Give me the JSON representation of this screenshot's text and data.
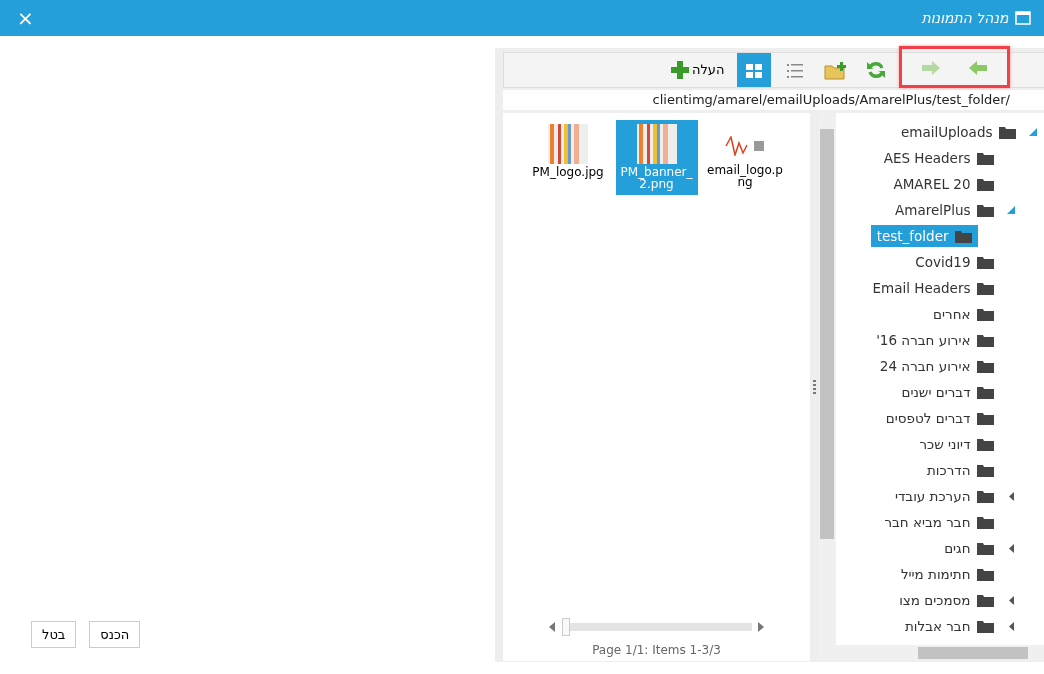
{
  "window": {
    "title": "מנהל התמונות",
    "close": "×"
  },
  "toolbar": {
    "nav": [
      {
        "kind": "back",
        "disabled": false
      },
      {
        "kind": "forward",
        "disabled": true
      }
    ],
    "views": [
      {
        "kind": "list",
        "selected": false
      },
      {
        "kind": "grid",
        "selected": true
      }
    ],
    "upload": "העלה"
  },
  "path": "clientimg/amarel/emailUploads/AmarelPlus/test_folder/",
  "files": [
    {
      "name": "email_logo.png",
      "selected": false,
      "kind": "logo"
    },
    {
      "name": "PM_banner_2.png",
      "selected": true,
      "kind": "stripes"
    },
    {
      "name": "PM_logo.jpg",
      "selected": false,
      "kind": "stripes"
    }
  ],
  "pager": {
    "level": 0,
    "text": "Page 1/1: Items 1-3/3"
  },
  "tree": [
    {
      "label": "emailUploads",
      "expanded": true,
      "selected": false,
      "children": [
        {
          "label": "AES Headers",
          "selected": false
        },
        {
          "label": "AMAREL 20",
          "selected": false
        },
        {
          "label": "AmarelPlus",
          "expanded": true,
          "selected": false,
          "children": [
            {
              "label": "test_folder",
              "selected": true
            }
          ]
        },
        {
          "label": "Covid19",
          "selected": false
        },
        {
          "label": "Email Headers",
          "selected": false
        },
        {
          "label": "אחרים",
          "selected": false
        },
        {
          "label": "אירוע חברה 16'",
          "selected": false
        },
        {
          "label": "אירוע חברה 24",
          "selected": false
        },
        {
          "label": "דברים ישנים",
          "selected": false
        },
        {
          "label": "דברים לטפסים",
          "selected": false
        },
        {
          "label": "דיוני שכר",
          "selected": false
        },
        {
          "label": "הדרכות",
          "selected": false
        },
        {
          "label": "הערכת עובדי",
          "expanded": false,
          "selected": false
        },
        {
          "label": "חבר מביא חבר",
          "selected": false
        },
        {
          "label": "חגים",
          "expanded": false,
          "selected": false
        },
        {
          "label": "חתימות מייל",
          "selected": false
        },
        {
          "label": "מסמכים מצו",
          "expanded": false,
          "selected": false
        },
        {
          "label": "חבר אבלות",
          "expanded": false,
          "selected": false
        }
      ]
    }
  ],
  "buttons": [
    {
      "label": "הכנס"
    },
    {
      "label": "בטל"
    }
  ]
}
